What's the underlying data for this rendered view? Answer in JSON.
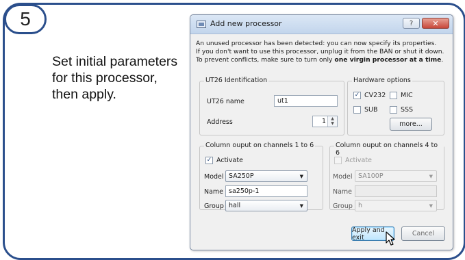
{
  "step_number": "5",
  "instruction_lines": [
    "Set initial parameters",
    "for this processor,",
    "then apply."
  ],
  "dialog": {
    "title": "Add new processor",
    "help_button": "?",
    "close_button": "✕",
    "info": {
      "line1": "An unused processor has been detected: you can now specify its properties.",
      "line2": "If you don't want to use this processor, unplug it from the BAN or shut it down.",
      "line3_prefix": "To prevent conflicts, make sure to turn only ",
      "line3_bold": "one virgin processor at a time",
      "line3_suffix": "."
    },
    "identification": {
      "title": "UT26 Identification",
      "name_label": "UT26 name",
      "name_value": "ut1",
      "address_label": "Address",
      "address_value": "1"
    },
    "hardware": {
      "title": "Hardware options",
      "options": [
        {
          "label": "CV232",
          "checked": true
        },
        {
          "label": "MIC",
          "checked": false
        },
        {
          "label": "SUB",
          "checked": false
        },
        {
          "label": "SSS",
          "checked": false
        }
      ],
      "more_button": "more..."
    },
    "left_output": {
      "title": "Column ouput on channels 1 to 6",
      "activate_label": "Activate",
      "activate_checked": true,
      "model_label": "Model",
      "model_value": "SA250P",
      "name_label": "Name",
      "name_value": "sa250p-1",
      "group_label": "Group",
      "group_value": "hall"
    },
    "right_output": {
      "title": "Column ouput on channels 4 to 6",
      "activate_label": "Activate",
      "activate_checked": false,
      "model_label": "Model",
      "model_value": "SA100P",
      "name_label": "Name",
      "name_value": "",
      "group_label": "Group",
      "group_value": "h"
    },
    "apply_button": "Apply and exit",
    "cancel_button": "Cancel"
  },
  "colors": {
    "card_border": "#2b4f8c",
    "dialog_bg": "#f0f0f0",
    "primary_button": "#bee6fd"
  }
}
